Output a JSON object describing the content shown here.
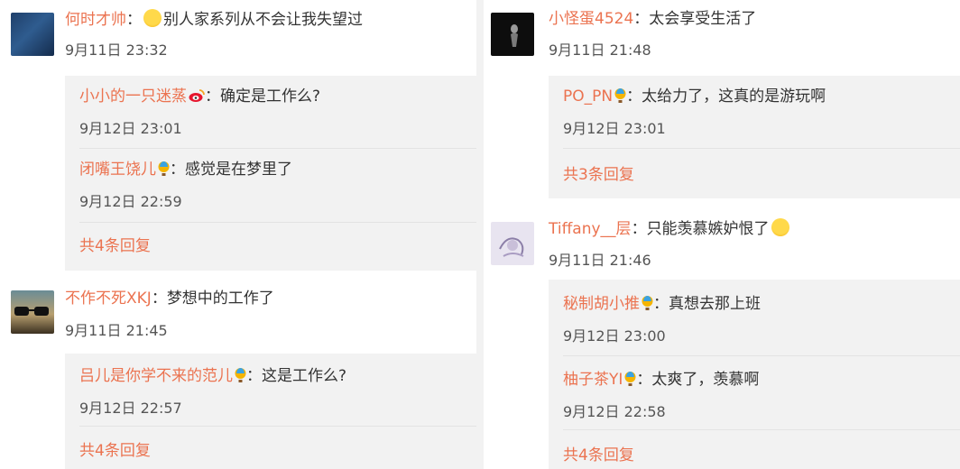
{
  "left": {
    "comments": [
      {
        "user": "何时才帅",
        "text": "别人家系列从不会让我失望过",
        "time": "9月11日 23:32",
        "avatar_icon": "dark-blue-square-avatar",
        "emoji": "laughing-emoji",
        "replies": [
          {
            "user": "小小的一只迷蒸",
            "text": "确定是工作么?",
            "time": "9月12日 23:01",
            "badge": "weibo-logo-icon"
          },
          {
            "user": "闭嘴王饶儿",
            "text": "感觉是在梦里了",
            "time": "9月12日 22:59",
            "badge": "hot-air-balloon-icon"
          }
        ],
        "more": "共4条回复"
      },
      {
        "user": "不作不死XKJ",
        "text": "梦想中的工作了",
        "time": "9月11日 21:45",
        "avatar_icon": "sunglasses-avatar",
        "replies": [
          {
            "user": "吕儿是你学不来的范儿",
            "text": "这是工作么?",
            "time": "9月12日 22:57",
            "badge": "hot-air-balloon-icon"
          }
        ],
        "more": "共4条回复"
      }
    ]
  },
  "right": {
    "comments": [
      {
        "user": "小怪蛋4524",
        "text": "太会享受生活了",
        "time": "9月11日 21:48",
        "avatar_icon": "black-figure-avatar",
        "replies": [
          {
            "user": "PO_PN",
            "text": "太给力了，这真的是游玩啊",
            "time": "9月12日 23:01",
            "badge": "hot-air-balloon-icon"
          }
        ],
        "more": "共3条回复"
      },
      {
        "user": "Tiffany__层",
        "text": "只能羡慕嫉妒恨了",
        "time": "9月11日 21:46",
        "avatar_icon": "sketch-avatar",
        "emoji": "laughing-emoji",
        "replies": [
          {
            "user": "秘制胡小推",
            "text": "真想去那上班",
            "time": "9月12日 23:00",
            "badge": "hot-air-balloon-icon"
          },
          {
            "user": "柚子茶YI",
            "text": "太爽了，羡慕啊",
            "time": "9月12日 22:58",
            "badge": "hot-air-balloon-icon"
          }
        ],
        "more": "共4条回复"
      }
    ]
  },
  "colors": {
    "username": "#eb7350",
    "text": "#333333",
    "time": "#555555",
    "reply_bg": "#f2f2f2"
  }
}
